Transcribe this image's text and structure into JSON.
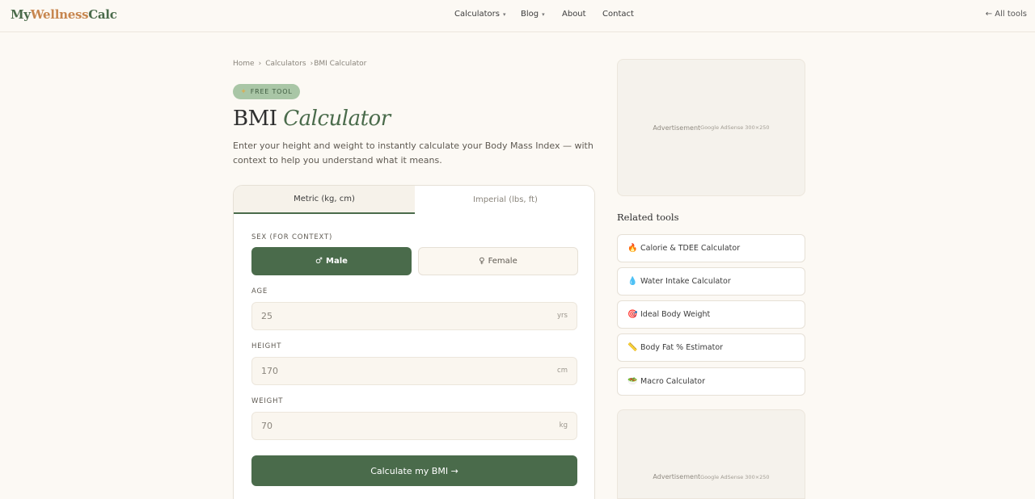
{
  "nav": {
    "logo_part1": "My",
    "logo_part2": "Wellness",
    "logo_part3": "Calc",
    "links": [
      {
        "label": "Calculators",
        "has_caret": true
      },
      {
        "label": "Blog",
        "has_caret": true
      },
      {
        "label": "About",
        "has_caret": false
      },
      {
        "label": "Contact",
        "has_caret": false
      }
    ],
    "caret": "▾",
    "all_tools": "← All tools"
  },
  "breadcrumb": {
    "items": [
      "Home",
      "Calculators",
      "BMI Calculator"
    ],
    "separator": "›"
  },
  "badge": {
    "icon": "✦",
    "label": "FREE TOOL"
  },
  "header": {
    "title_plain": "BMI ",
    "title_italic": "Calculator",
    "subtitle": "Enter your height and weight to instantly calculate your Body Mass Index — with context to help you understand what it means."
  },
  "form": {
    "tabs": [
      {
        "label": "Metric (kg, cm)",
        "active": true
      },
      {
        "label": "Imperial (lbs, ft)",
        "active": false
      }
    ],
    "sex_label": "SEX (FOR CONTEXT)",
    "male_icon": "♂",
    "male_label": "Male",
    "female_icon": "♀",
    "female_label": "Female",
    "age_label": "AGE",
    "age_value": "25",
    "age_unit": "yrs",
    "height_label": "HEIGHT",
    "height_value": "170",
    "height_unit": "cm",
    "weight_label": "WEIGHT",
    "weight_value": "70",
    "weight_unit": "kg",
    "submit_label": "Calculate my BMI →"
  },
  "sidebar": {
    "ad_label": "Advertisement",
    "ad_size": "Google AdSense 300×250",
    "related_title": "Related tools",
    "related": [
      {
        "icon": "🔥",
        "label": "Calorie & TDEE Calculator"
      },
      {
        "icon": "💧",
        "label": "Water Intake Calculator"
      },
      {
        "icon": "🎯",
        "label": "Ideal Body Weight"
      },
      {
        "icon": "📏",
        "label": "Body Fat % Estimator"
      },
      {
        "icon": "🥗",
        "label": "Macro Calculator"
      }
    ]
  },
  "colors": {
    "accent_green": "#4a6b4b",
    "logo_orange": "#c7864f",
    "badge_green": "#a9c6a6",
    "background": "#fcf9f4"
  }
}
